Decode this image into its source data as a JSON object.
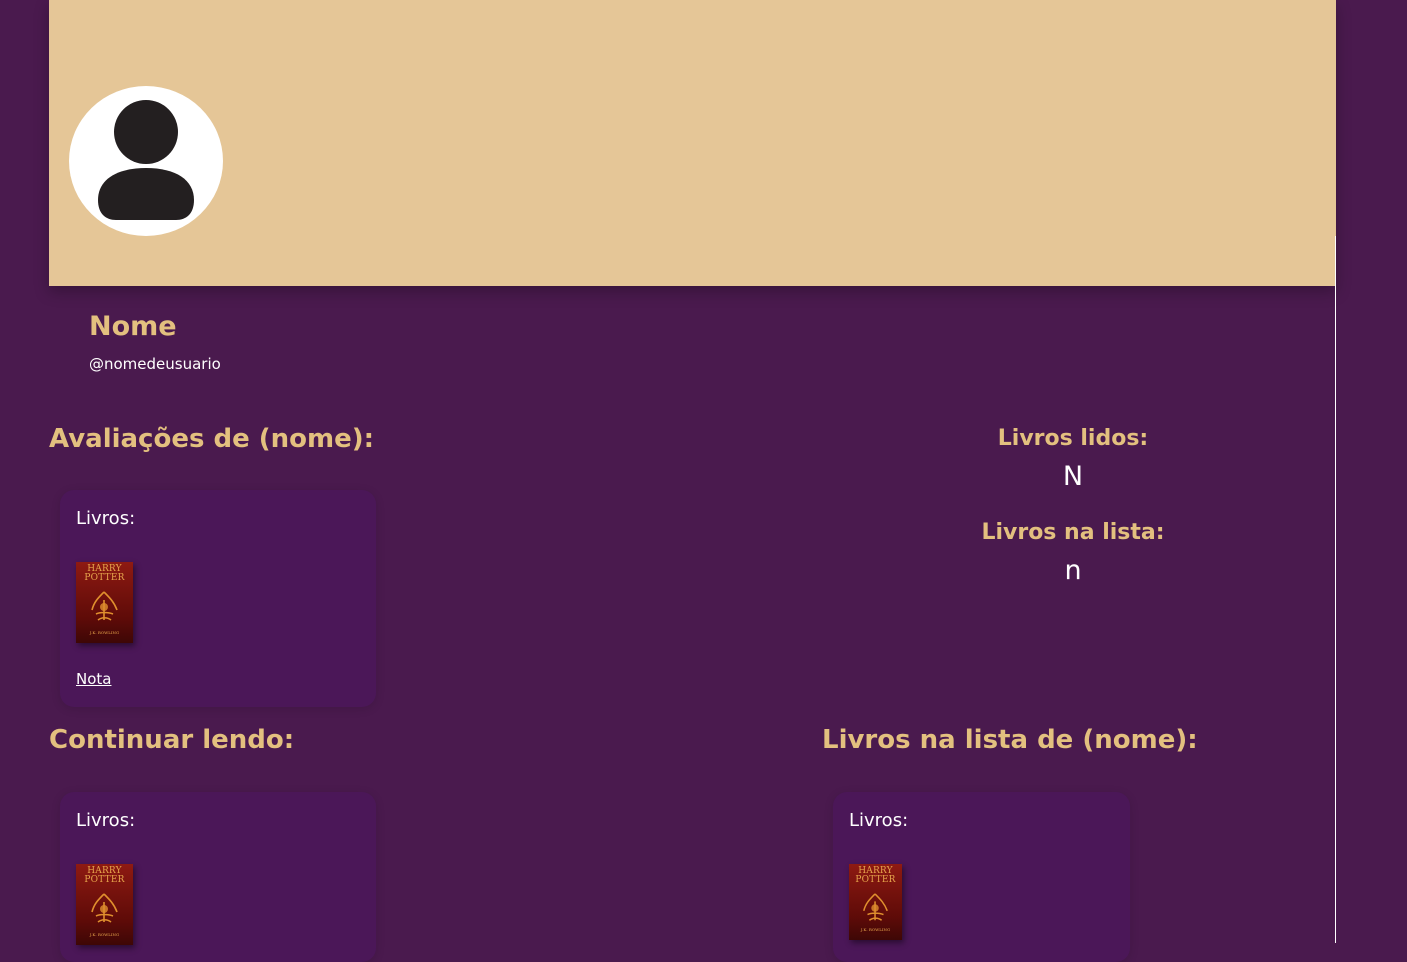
{
  "colors": {
    "page_background": "#4a1a4e",
    "banner": "#e5c697",
    "accent_text": "#e3c07f",
    "card_background": "#4b1758",
    "book_cover": "#7a1410"
  },
  "profile": {
    "avatar_icon": "user-silhouette-icon",
    "name": "Nome",
    "username": "@nomedeusuario"
  },
  "reviews": {
    "title": "Avaliações de (nome):",
    "card": {
      "label": "Livros:",
      "book": {
        "title_line1": "HARRY",
        "title_line2": "POTTER",
        "author": "J.K. ROWLING"
      },
      "link": "Nota"
    }
  },
  "stats": {
    "read_label": "Livros lidos:",
    "read_value": "N",
    "list_label": "Livros na lista:",
    "list_value": "n"
  },
  "continue_reading": {
    "title": "Continuar lendo:",
    "card": {
      "label": "Livros:",
      "book": {
        "title_line1": "HARRY",
        "title_line2": "POTTER",
        "author": "J.K. ROWLING"
      }
    }
  },
  "reading_list": {
    "title": "Livros na lista de (nome):",
    "card": {
      "label": "Livros:",
      "book": {
        "title_line1": "HARRY",
        "title_line2": "POTTER",
        "author": "J.K. ROWLING"
      }
    }
  }
}
